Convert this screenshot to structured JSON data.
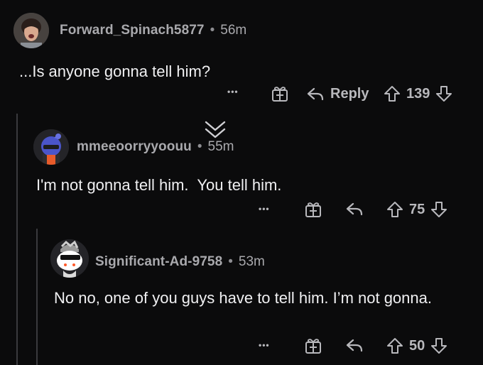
{
  "comments": [
    {
      "username": "Forward_Spinach5877",
      "separator": "•",
      "time": "56m",
      "body": "...Is anyone gonna tell him?",
      "more": "•••",
      "reply_label": "Reply",
      "score": "139"
    },
    {
      "username": "mmeeoorryyoouu",
      "separator": "•",
      "time": "55m",
      "body": "I'm not gonna tell him.  You tell him.",
      "more": "•••",
      "score": "75"
    },
    {
      "username": "Significant-Ad-9758",
      "separator": "•",
      "time": "53m",
      "body": "No no, one of you guys have to tell him. I’m not gonna.",
      "more": "•••",
      "score": "50"
    }
  ],
  "icons": {
    "collapse": "chevron-down-icon",
    "award": "award-icon",
    "reply": "reply-arrow-icon",
    "upvote": "upvote-icon",
    "downvote": "downvote-icon"
  },
  "colors": {
    "background": "#0b0b0c",
    "text": "#f0f0f2",
    "muted": "#a9a9ad"
  }
}
